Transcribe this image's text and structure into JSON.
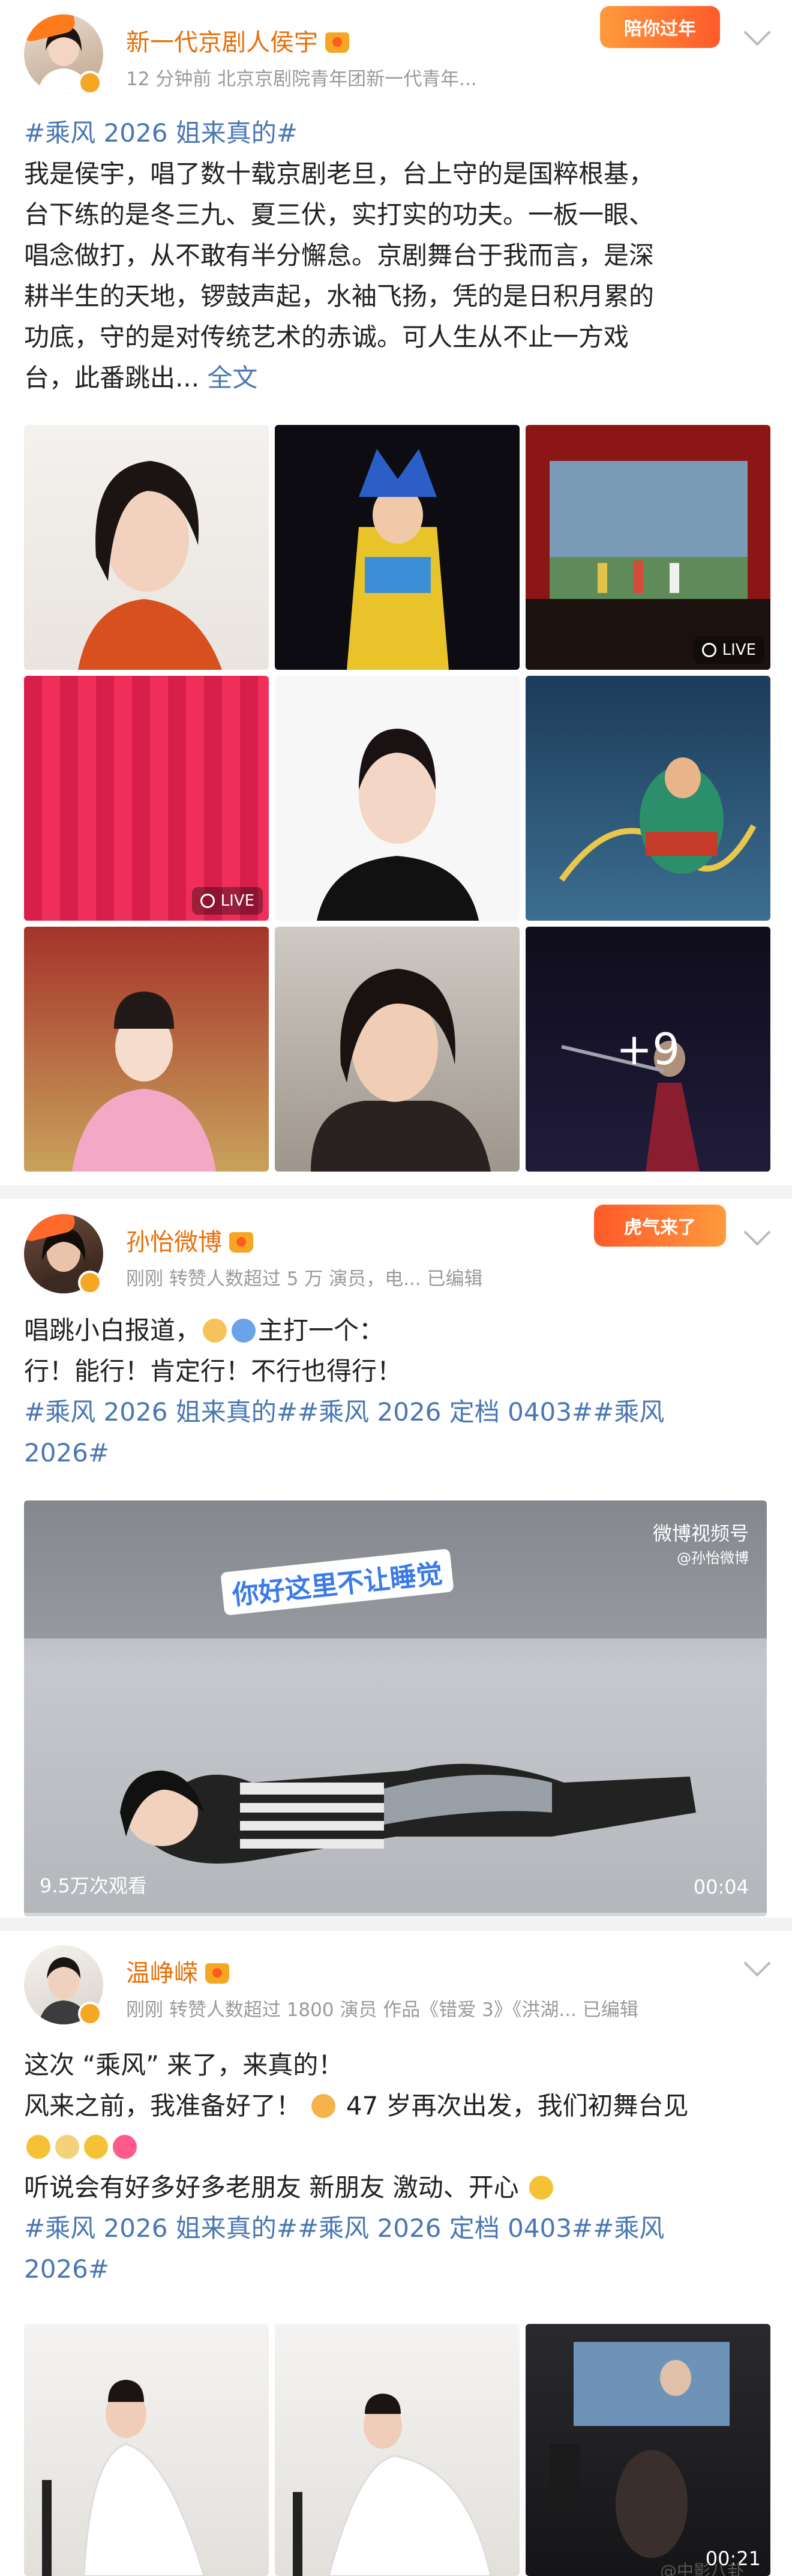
{
  "posts": [
    {
      "username": "新一代京剧人侯宇",
      "meta": "12 分钟前   北京京剧院青年团新一代青年...",
      "sticker": "陪你过年",
      "hashtag": "#乘风 2026 姐来真的#",
      "text_lines": [
        "我是侯宇，唱了数十载京剧老旦，台上守的是国粹根基，",
        "台下练的是冬三九、夏三伏，实打实的功夫。一板一眼、",
        "唱念做打，从不敢有半分懈怠。京剧舞台于我而言，是深",
        "耕半生的天地，锣鼓声起，水袖飞扬，凭的是日积月累的",
        "功底，守的是对传统艺术的赤诚。可人生从不止一方戏"
      ],
      "last_line": "台，此番跳出...",
      "expand_label": "全文",
      "live_label": "LIVE",
      "more_count": "+9",
      "image_names": [
        "photo-portrait-orange",
        "photo-opera-costume",
        "photo-stage-performance",
        "photo-red-curtain",
        "photo-portrait-black",
        "photo-opera-battle",
        "photo-opera-pink",
        "photo-portrait-closeup",
        "photo-more-opera"
      ]
    },
    {
      "username": "孙怡微博",
      "meta": "刚刚  转赞人数超过 5 万   演员，电...   已编辑",
      "sticker": "虎气来了",
      "line1": "唱跳小白报道，",
      "line1_end": "主打一个：",
      "line2": "行！能行！肯定行！不行也得行！",
      "tags_line1": "#乘风 2026 姐来真的##乘风 2026 定档 0403##乘风",
      "tags_line2": "2026#",
      "video": {
        "caption": "你好这里不让睡觉",
        "watermark": "微博视频号",
        "watermark_sub": "@孙怡微博",
        "views": "9.5万次观看",
        "duration": "00:04"
      }
    },
    {
      "username": "温峥嵘",
      "meta": "刚刚  转赞人数超过 1800   演员  作品《错爱 3》《洪湖...   已编辑",
      "line1": "这次 “乘风” 来了，来真的！",
      "line2": "风来之前，我准备好了！",
      "line2_end": "47 岁再次出发，我们初舞台见",
      "line4": "听说会有好多好多老朋友 新朋友 激动、开心",
      "tags_line1": "#乘风 2026 姐来真的##乘风 2026 定档 0403##乘风",
      "tags_line2": "2026#",
      "time_badge": "00:21",
      "watermark": "@中影八卦"
    }
  ],
  "colors": {
    "username": "#e8700a",
    "hashtag": "#4a77b3",
    "meta": "#9a9a9a",
    "separator": "#f2f2f2"
  }
}
